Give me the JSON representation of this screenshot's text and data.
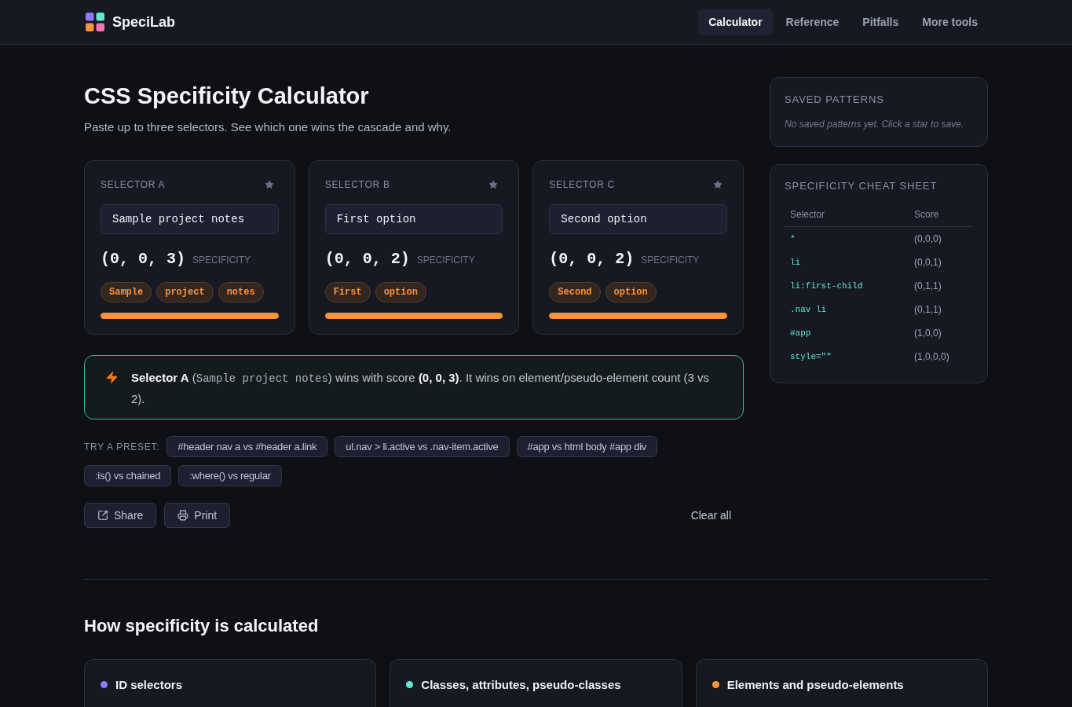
{
  "header": {
    "brand": "SpeciLab",
    "nav": [
      {
        "label": "Calculator",
        "selected": true
      },
      {
        "label": "Reference",
        "selected": false
      },
      {
        "label": "Pitfalls",
        "selected": false
      },
      {
        "label": "More tools",
        "selected": false
      }
    ]
  },
  "calculator": {
    "title": "CSS Specificity Calculator",
    "subtitle": "Paste up to three selectors. See which one wins the cascade and why.",
    "selectors": [
      {
        "label": "SELECTOR A",
        "value": "Sample project notes",
        "score": "(0, 0, 3)",
        "score_label": "SPECIFICITY",
        "tokens": [
          "Sample",
          "project",
          "notes"
        ],
        "level": 1
      },
      {
        "label": "SELECTOR B",
        "value": "First option",
        "score": "(0, 0, 2)",
        "score_label": "SPECIFICITY",
        "tokens": [
          "First",
          "option"
        ],
        "level": 1
      },
      {
        "label": "SELECTOR C",
        "value": "Second option",
        "score": "(0, 0, 2)",
        "score_label": "SPECIFICITY",
        "tokens": [
          "Second",
          "option"
        ],
        "level": 1
      }
    ],
    "verdict": {
      "segments": [
        {
          "kind": "strong",
          "text": "Selector A"
        },
        {
          "kind": "plain",
          "text": " ("
        },
        {
          "kind": "code",
          "text": "Sample project notes"
        },
        {
          "kind": "plain",
          "text": ") wins with score "
        },
        {
          "kind": "strong",
          "text": "(0, 0, 3)"
        },
        {
          "kind": "plain",
          "text": ". It wins on element/pseudo-element count (3 vs 2)."
        }
      ]
    },
    "presets": {
      "label": "TRY A PRESET:",
      "items": [
        "#header nav a vs #header a.link",
        "ul.nav > li.active vs .nav-item.active",
        "#app vs html body #app div",
        ":is() vs chained",
        ":where() vs regular"
      ]
    },
    "actions": [
      {
        "kind": "share",
        "label": "Share"
      },
      {
        "kind": "print",
        "label": "Print"
      }
    ],
    "clear_label": "Clear all"
  },
  "sidebar": {
    "saved": {
      "title": "SAVED PATTERNS",
      "empty_text": "No saved patterns yet. Click a star to save."
    },
    "cheat_sheet": {
      "title": "SPECIFICITY CHEAT SHEET",
      "columns": [
        "Selector",
        "Score"
      ],
      "rows": [
        {
          "selector": "*",
          "score": "(0,0,0)"
        },
        {
          "selector": "li",
          "score": "(0,0,1)"
        },
        {
          "selector": "li:first-child",
          "score": "(0,1,1)"
        },
        {
          "selector": ".nav li",
          "score": "(0,1,1)"
        },
        {
          "selector": "#app",
          "score": "(1,0,0)"
        },
        {
          "selector": "style=\"\"",
          "score": "(1,0,0,0)"
        }
      ]
    }
  },
  "explainer": {
    "title": "How specificity is calculated",
    "cards": [
      {
        "title": "ID selectors",
        "color": "#8b7cf6"
      },
      {
        "title": "Classes, attributes, pseudo-classes",
        "color": "#5eead4"
      },
      {
        "title": "Elements and pseudo-elements",
        "color": "#fb923c"
      }
    ]
  }
}
